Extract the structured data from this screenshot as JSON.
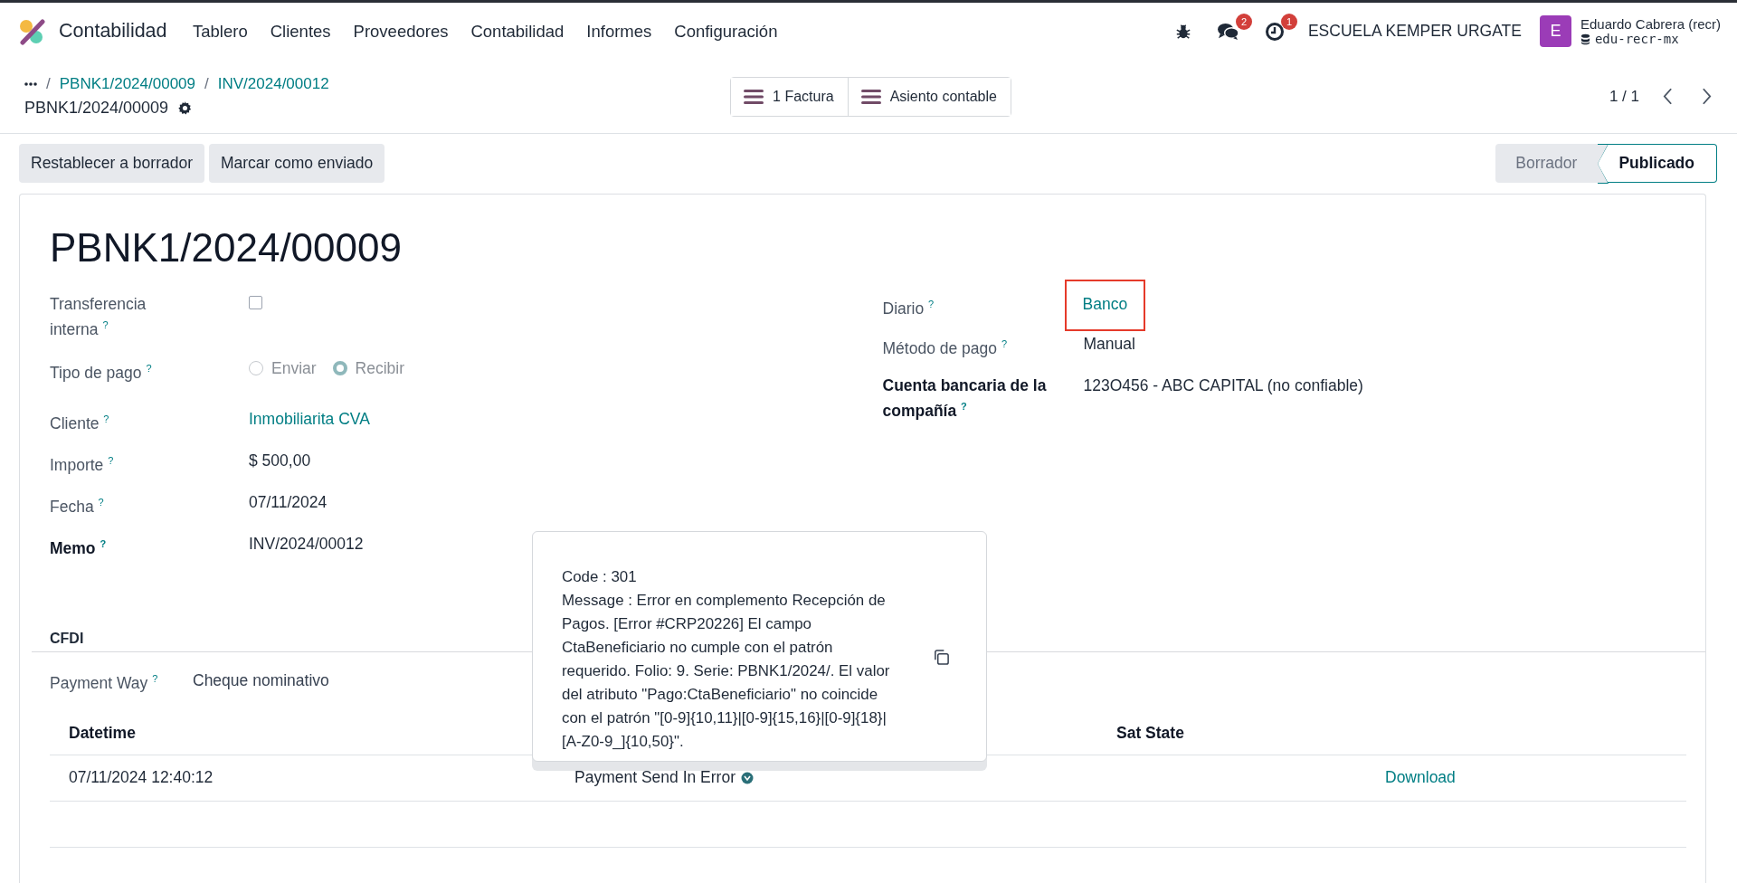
{
  "navbar": {
    "app_name": "Contabilidad",
    "menu": [
      "Tablero",
      "Clientes",
      "Proveedores",
      "Contabilidad",
      "Informes",
      "Configuración"
    ],
    "systray": [
      {
        "kind": "debug"
      },
      {
        "kind": "messages",
        "badge": "2"
      },
      {
        "kind": "activities",
        "badge": "1"
      }
    ],
    "company": "ESCUELA KEMPER URGATE",
    "user": {
      "avatar": "E",
      "name": "Eduardo Cabrera (recr)",
      "database": "edu-recr-mx"
    }
  },
  "breadcrumbs": {
    "separator": "/",
    "items": [
      "PBNK1/2024/00009",
      "INV/2024/00012"
    ],
    "current": "PBNK1/2024/00009"
  },
  "smart_buttons": [
    {
      "label": "1 Factura"
    },
    {
      "label": "Asiento contable"
    }
  ],
  "pager": "1 / 1",
  "actions": [
    "Restablecer a borrador",
    "Marcar como enviado"
  ],
  "status_bar": [
    {
      "label": "Borrador",
      "selected": false
    },
    {
      "label": "Publicado",
      "selected": true
    }
  ],
  "record_title": "PBNK1/2024/00009",
  "left_fields": [
    {
      "label": "Transferencia interna",
      "help": "?",
      "kind": "checkbox",
      "checked": false
    },
    {
      "label": "Tipo de pago",
      "help": "?",
      "kind": "radio",
      "options": [
        {
          "label": "Enviar",
          "selected": false
        },
        {
          "label": "Recibir",
          "selected": true
        }
      ]
    },
    {
      "label": "Cliente",
      "help": "?",
      "kind": "link",
      "value": "Inmobiliarita CVA"
    },
    {
      "label": "Importe",
      "help": "?",
      "kind": "text",
      "value": "$ 500,00"
    },
    {
      "label": "Fecha",
      "help": "?",
      "kind": "text",
      "value": "07/11/2024"
    },
    {
      "label": "Memo",
      "help": "?",
      "kind": "text",
      "value": "INV/2024/00012",
      "bold": true
    }
  ],
  "right_fields": [
    {
      "label": "Diario",
      "help": "?",
      "kind": "link",
      "value": "Banco",
      "highlighted": true
    },
    {
      "label": "Método de pago",
      "help": "?",
      "kind": "text",
      "value": "Manual"
    },
    {
      "label": "Cuenta bancaria de la compañía",
      "help": "?",
      "kind": "text",
      "value": "123O456 - ABC CAPITAL (no confiable)",
      "bold": true
    }
  ],
  "section": {
    "title": "CFDI",
    "fields": [
      {
        "label": "Payment Way",
        "help": "?",
        "kind": "text",
        "value": "Cheque nominativo"
      }
    ]
  },
  "table": {
    "column_1": "Datetime",
    "column_3": "Sat State",
    "rows": [
      {
        "datetime": "07/11/2024 12:40:12",
        "status": "Payment Send In Error",
        "action": "Download"
      }
    ]
  },
  "popover": {
    "code": "Code : 301",
    "message": "Message : Error en complemento Recepción de Pagos. [Error #CRP20226] El campo CtaBeneficiario no cumple con el patrón requerido. Folio: 9. Serie: PBNK1/2024/. El valor del atributo \"Pago:CtaBeneficiario\" no coincide con el patrón \"[0-9]{10,11}|[0-9]{15,16}|[0-9]{18}|[A-Z0-9_]{10,50}\"."
  }
}
